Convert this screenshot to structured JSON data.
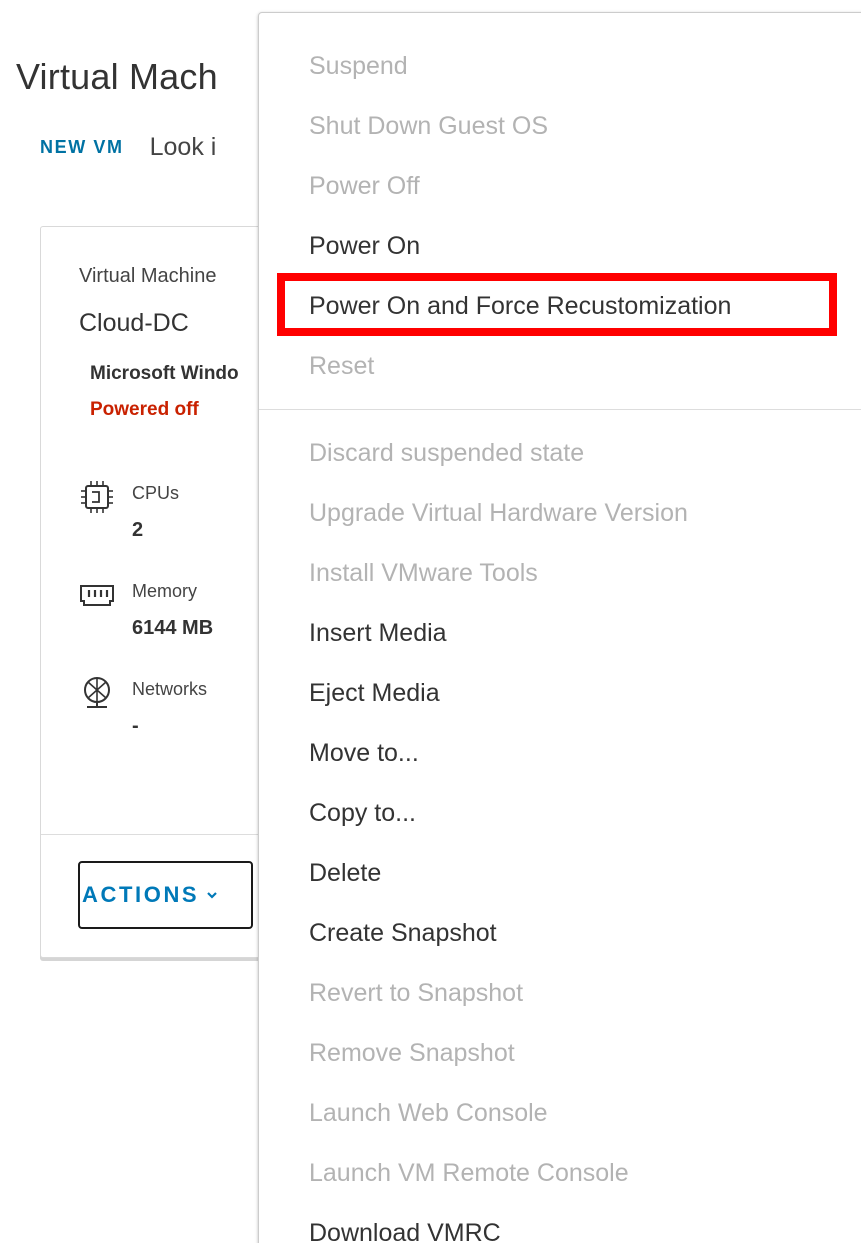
{
  "page": {
    "title": "Virtual Mach"
  },
  "toolbar": {
    "new_vm_label": "NEW VM",
    "search_text": "Look i"
  },
  "vm_card": {
    "type_label": "Virtual Machine",
    "name": "Cloud-DC",
    "os": "Microsoft Windo",
    "power_state": "Powered off",
    "specs": [
      {
        "icon": "cpu-icon",
        "label": "CPUs",
        "value": "2"
      },
      {
        "icon": "memory-icon",
        "label": "Memory",
        "value": "6144 MB"
      },
      {
        "icon": "network-icon",
        "label": "Networks",
        "value": "-"
      }
    ],
    "actions_label": "ACTIONS"
  },
  "menu": {
    "items": [
      {
        "label": "Suspend",
        "enabled": false
      },
      {
        "label": "Shut Down Guest OS",
        "enabled": false
      },
      {
        "label": "Power Off",
        "enabled": false
      },
      {
        "label": "Power On",
        "enabled": true
      },
      {
        "label": "Power On and Force Recustomization",
        "enabled": true,
        "highlighted": true
      },
      {
        "label": "Reset",
        "enabled": false
      },
      {
        "label": "Discard suspended state",
        "enabled": false
      },
      {
        "label": "Upgrade Virtual Hardware Version",
        "enabled": false
      },
      {
        "label": "Install VMware Tools",
        "enabled": false
      },
      {
        "label": "Insert Media",
        "enabled": true
      },
      {
        "label": "Eject Media",
        "enabled": true
      },
      {
        "label": "Move to...",
        "enabled": true
      },
      {
        "label": "Copy to...",
        "enabled": true
      },
      {
        "label": "Delete",
        "enabled": true
      },
      {
        "label": "Create Snapshot",
        "enabled": true
      },
      {
        "label": "Revert to Snapshot",
        "enabled": false
      },
      {
        "label": "Remove Snapshot",
        "enabled": false
      },
      {
        "label": "Launch Web Console",
        "enabled": false
      },
      {
        "label": "Launch VM Remote Console",
        "enabled": false
      },
      {
        "label": "Download VMRC",
        "enabled": true
      }
    ]
  },
  "colors": {
    "link": "#0072a3",
    "powered_off": "#c92100",
    "disabled_text": "#b3b3b3",
    "highlight": "#ff0000"
  }
}
